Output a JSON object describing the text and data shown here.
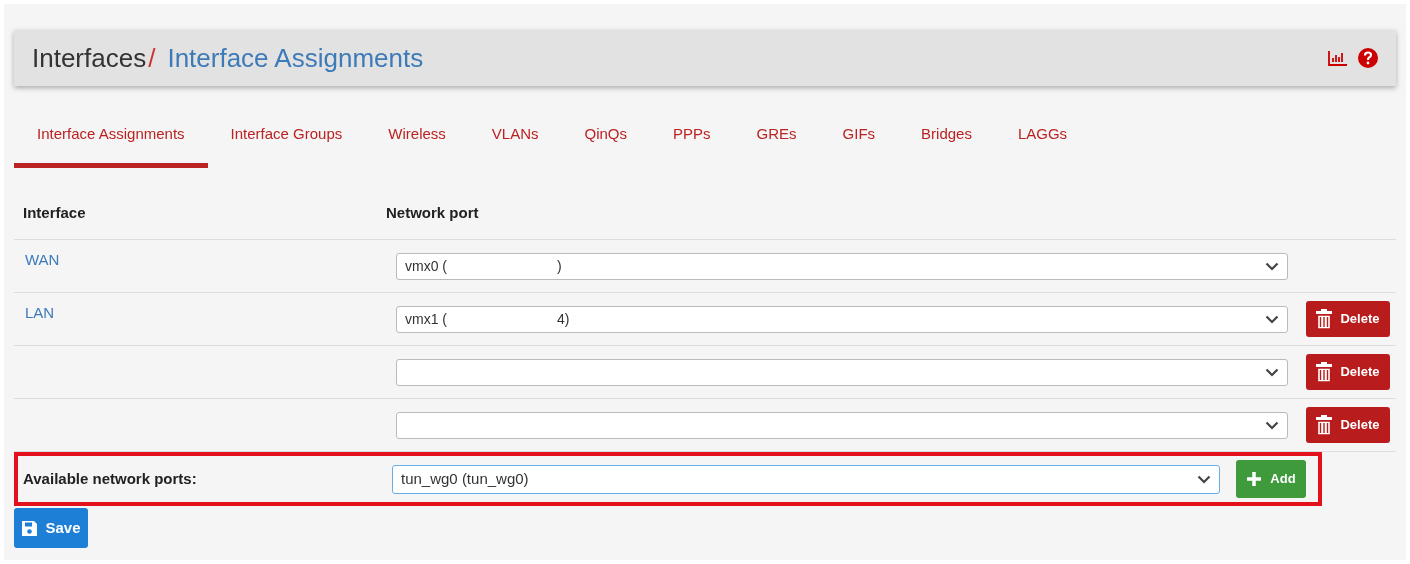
{
  "breadcrumb": {
    "parent": "Interfaces",
    "separator": "/",
    "current": "Interface Assignments"
  },
  "tabs": [
    {
      "label": "Interface Assignments",
      "selected": true
    },
    {
      "label": "Interface Groups",
      "selected": false
    },
    {
      "label": "Wireless",
      "selected": false
    },
    {
      "label": "VLANs",
      "selected": false
    },
    {
      "label": "QinQs",
      "selected": false
    },
    {
      "label": "PPPs",
      "selected": false
    },
    {
      "label": "GREs",
      "selected": false
    },
    {
      "label": "GIFs",
      "selected": false
    },
    {
      "label": "Bridges",
      "selected": false
    },
    {
      "label": "LAGGs",
      "selected": false
    }
  ],
  "table": {
    "columns": [
      "Interface",
      "Network port"
    ],
    "rows": [
      {
        "name": "WAN",
        "port_start": "vmx0 (",
        "port_end": ")",
        "deletable": false
      },
      {
        "name": "LAN",
        "port_start": "vmx1 (",
        "port_end": "4)",
        "deletable": true,
        "delete_label": "Delete"
      },
      {
        "deletable": true,
        "delete_label": "Delete"
      },
      {
        "deletable": true,
        "delete_label": "Delete"
      }
    ]
  },
  "available": {
    "label": "Available network ports:",
    "port": "tun_wg0 (tun_wg0)",
    "add_label": "Add",
    "highlighted": true
  },
  "save_label": "Save"
}
